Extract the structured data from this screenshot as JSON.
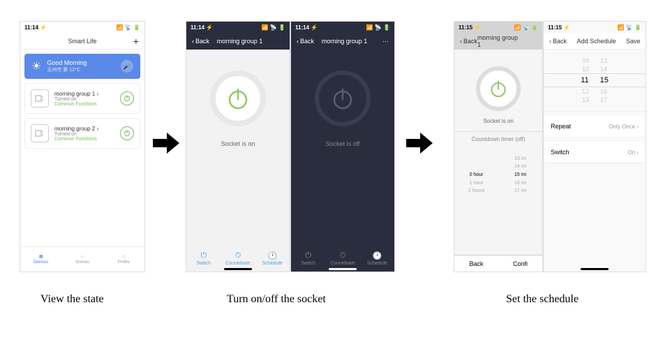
{
  "times": {
    "t1": "11:14 ⚡",
    "t2": "11:14 ⚡",
    "t3": "11:14 ⚡",
    "t4": "11:15 ⚡",
    "t5": "11:15 ⚡",
    "signal": "📶 📡 🔋"
  },
  "captions": {
    "c1": "View the state",
    "c2": "Turn on/off the socket",
    "c3": "Set the schedule"
  },
  "p1": {
    "title": "Smart Life",
    "add": "+",
    "banner_title": "Good Morning",
    "banner_sub": "无州市  第  12°C",
    "devices": [
      {
        "name": "morning group 1  ›",
        "status": "Turned on",
        "common": "Common Functions"
      },
      {
        "name": "morning group 2  ›",
        "status": "Turned on",
        "common": "Common Functions"
      }
    ],
    "tabs": {
      "devices": "Devices",
      "scenes": "Scenes",
      "profile": "Profile"
    }
  },
  "p2": {
    "back": "Back",
    "title": "morning group 1",
    "state": "Socket is on",
    "tabs": {
      "switch": "Switch",
      "countdown": "Countdown",
      "schedule": "Schedule"
    }
  },
  "p3": {
    "back": "Back",
    "title": "morning group 1",
    "more": "···",
    "state": "Socket is off",
    "tabs": {
      "switch": "Switch",
      "countdown": "Countdown",
      "schedule": "Schedule"
    }
  },
  "p4": {
    "back": "Back",
    "title": "morning group 1",
    "state": "Socket is on",
    "countdown": "Countdown timer (off)",
    "hours": {
      "r0": "",
      "sel": "0 hour",
      "r2": "1 hour",
      "r3": "2 hours"
    },
    "mins": {
      "r0": "13 mi",
      "r1": "14 mi",
      "sel": "15 mi",
      "r3": "16 mi",
      "r4": "17 mi"
    },
    "actions": {
      "back": "Back",
      "confirm": "Confi"
    }
  },
  "p5": {
    "back": "Back",
    "title": "Add Schedule",
    "save": "Save",
    "rows": [
      {
        "h": "09",
        "m": "13"
      },
      {
        "h": "10",
        "m": "14"
      },
      {
        "h": "11",
        "m": "15",
        "sel": true
      },
      {
        "h": "12",
        "m": "16"
      },
      {
        "h": "13",
        "m": "17"
      }
    ],
    "repeat": {
      "label": "Repeat",
      "val": "Only Once ›"
    },
    "switch": {
      "label": "Switch",
      "val": "On ›"
    }
  }
}
